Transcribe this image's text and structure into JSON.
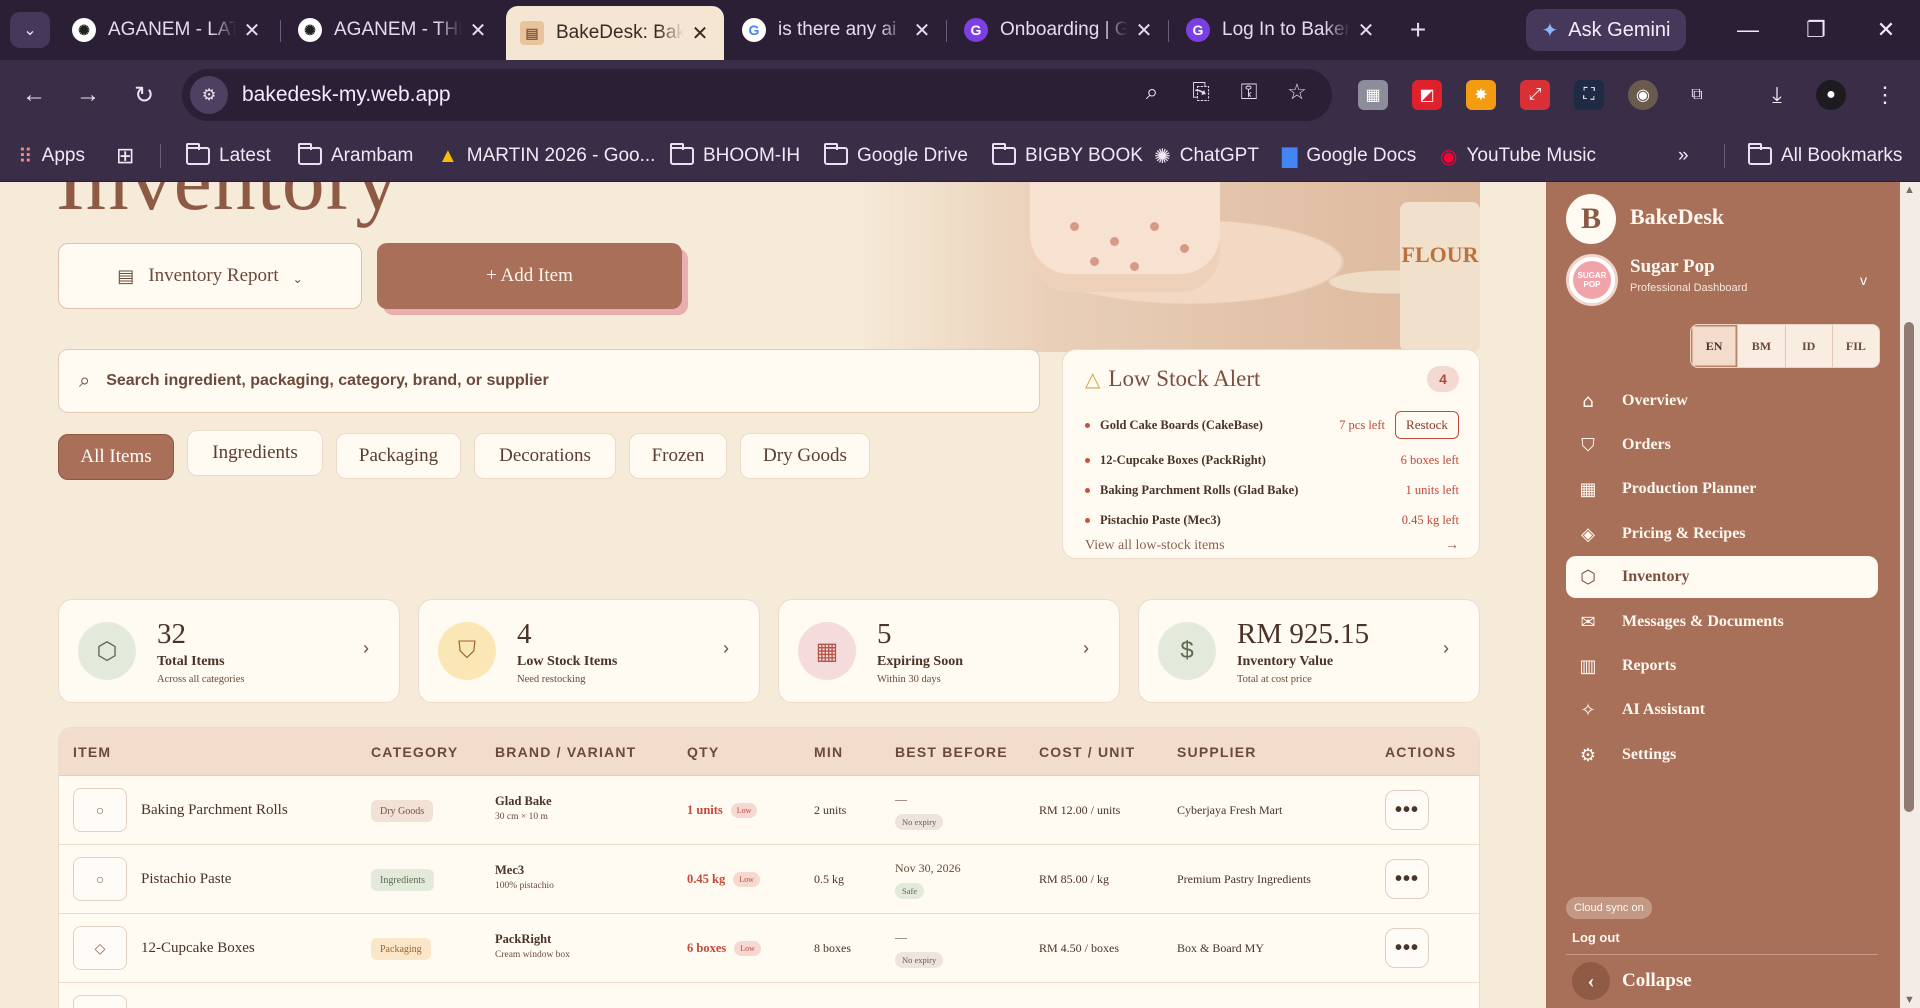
{
  "browser": {
    "tabs": [
      {
        "title": "AGANEM - LATEST",
        "icon": "chatgpt-icon"
      },
      {
        "title": "AGANEM - THE",
        "icon": "chatgpt-icon"
      },
      {
        "title": "BakeDesk: Bakery",
        "icon": "bakedesk-icon"
      },
      {
        "title": "is there any ai",
        "icon": "google-icon"
      },
      {
        "title": "Onboarding | G",
        "icon": "gamma-icon"
      },
      {
        "title": "Log In to Bakery",
        "icon": "gamma-icon"
      }
    ],
    "ask_gemini": "Ask Gemini",
    "url": "bakedesk-my.web.app",
    "bookmarks": [
      {
        "label": "Apps"
      },
      {
        "label": "Latest"
      },
      {
        "label": "Arambam"
      },
      {
        "label": "MARTIN 2026 - Goo..."
      },
      {
        "label": "BHOOM-IH"
      },
      {
        "label": "Google Drive"
      },
      {
        "label": "BIGBY BOOK"
      },
      {
        "label": "ChatGPT"
      },
      {
        "label": "Google Docs"
      },
      {
        "label": "YouTube Music"
      }
    ],
    "all_bookmarks": "All Bookmarks"
  },
  "page": {
    "title": "Inventory",
    "report_button": "Inventory Report",
    "add_button": "+ Add Item",
    "search_placeholder": "Search ingredient, packaging, category, brand, or supplier",
    "filters": [
      "All Items",
      "Ingredients",
      "Packaging",
      "Decorations",
      "Frozen",
      "Dry Goods"
    ],
    "hero_flour": "FLOUR"
  },
  "low_stock": {
    "title": "Low Stock Alert",
    "count": "4",
    "items": [
      {
        "name": "Gold Cake Boards (CakeBase)",
        "left": "7 pcs left",
        "action": "Restock"
      },
      {
        "name": "12-Cupcake Boxes (PackRight)",
        "left": "6 boxes left"
      },
      {
        "name": "Baking Parchment Rolls (Glad Bake)",
        "left": "1 units left"
      },
      {
        "name": "Pistachio Paste (Mec3)",
        "left": "0.45 kg left"
      }
    ],
    "view_all": "View all low-stock items",
    "arrow": "→"
  },
  "stats": [
    {
      "value": "32",
      "label": "Total Items",
      "sub": "Across all categories",
      "icon": "box-icon",
      "color": "#e3eadc"
    },
    {
      "value": "4",
      "label": "Low Stock Items",
      "sub": "Need restocking",
      "icon": "bag-icon",
      "color": "#fbe7b5"
    },
    {
      "value": "5",
      "label": "Expiring Soon",
      "sub": "Within 30 days",
      "icon": "calendar-icon",
      "color": "#f5dcdc"
    },
    {
      "value": "RM 925.15",
      "label": "Inventory Value",
      "sub": "Total at cost price",
      "icon": "dollar-icon",
      "color": "#e3eadc"
    }
  ],
  "table": {
    "headers": [
      "ITEM",
      "CATEGORY",
      "BRAND / VARIANT",
      "QTY",
      "MIN",
      "BEST BEFORE",
      "COST / UNIT",
      "SUPPLIER",
      "ACTIONS"
    ],
    "rows": [
      {
        "icon": "○",
        "name": "Baking Parchment Rolls",
        "category": "Dry Goods",
        "brand": "Glad Bake",
        "variant": "30 cm × 10 m",
        "qty": "1 units",
        "qty_tag": "Low",
        "min": "2 units",
        "best_before": "—",
        "bb_tag": "No expiry",
        "cost": "RM 12.00 / units",
        "supplier": "Cyberjaya Fresh Mart"
      },
      {
        "icon": "○",
        "name": "Pistachio Paste",
        "category": "Ingredients",
        "brand": "Mec3",
        "variant": "100% pistachio",
        "qty": "0.45 kg",
        "qty_tag": "Low",
        "min": "0.5 kg",
        "best_before": "Nov 30, 2026",
        "bb_tag": "Safe",
        "cost": "RM 85.00 / kg",
        "supplier": "Premium Pastry Ingredients"
      },
      {
        "icon": "◇",
        "name": "12-Cupcake Boxes",
        "category": "Packaging",
        "brand": "PackRight",
        "variant": "Cream window box",
        "qty": "6 boxes",
        "qty_tag": "Low",
        "min": "8 boxes",
        "best_before": "—",
        "bb_tag": "No expiry",
        "cost": "RM 4.50 / boxes",
        "supplier": "Box & Board MY"
      }
    ],
    "more": "•••"
  },
  "sidebar": {
    "logo": "B",
    "brand": "BakeDesk",
    "shop": "Sugar Pop",
    "shop_sub": "Professional Dashboard",
    "shop_caret": "v",
    "avatar_text": "SUGAR POP",
    "languages": [
      "EN",
      "BM",
      "ID",
      "FIL"
    ],
    "nav": [
      {
        "label": "Overview",
        "icon": "home-icon"
      },
      {
        "label": "Orders",
        "icon": "shopping-bag-icon"
      },
      {
        "label": "Production Planner",
        "icon": "calendar-icon"
      },
      {
        "label": "Pricing & Recipes",
        "icon": "tag-icon"
      },
      {
        "label": "Inventory",
        "icon": "box-icon"
      },
      {
        "label": "Messages & Documents",
        "icon": "mail-icon"
      },
      {
        "label": "Reports",
        "icon": "bar-chart-icon"
      },
      {
        "label": "AI Assistant",
        "icon": "sparkle-icon"
      },
      {
        "label": "Settings",
        "icon": "gear-icon"
      }
    ],
    "sync": "Cloud sync on",
    "logout": "Log out",
    "collapse": "Collapse"
  },
  "colors": {
    "accent": "#a87058",
    "background": "#f6ead8",
    "alert": "#c14a3a"
  }
}
